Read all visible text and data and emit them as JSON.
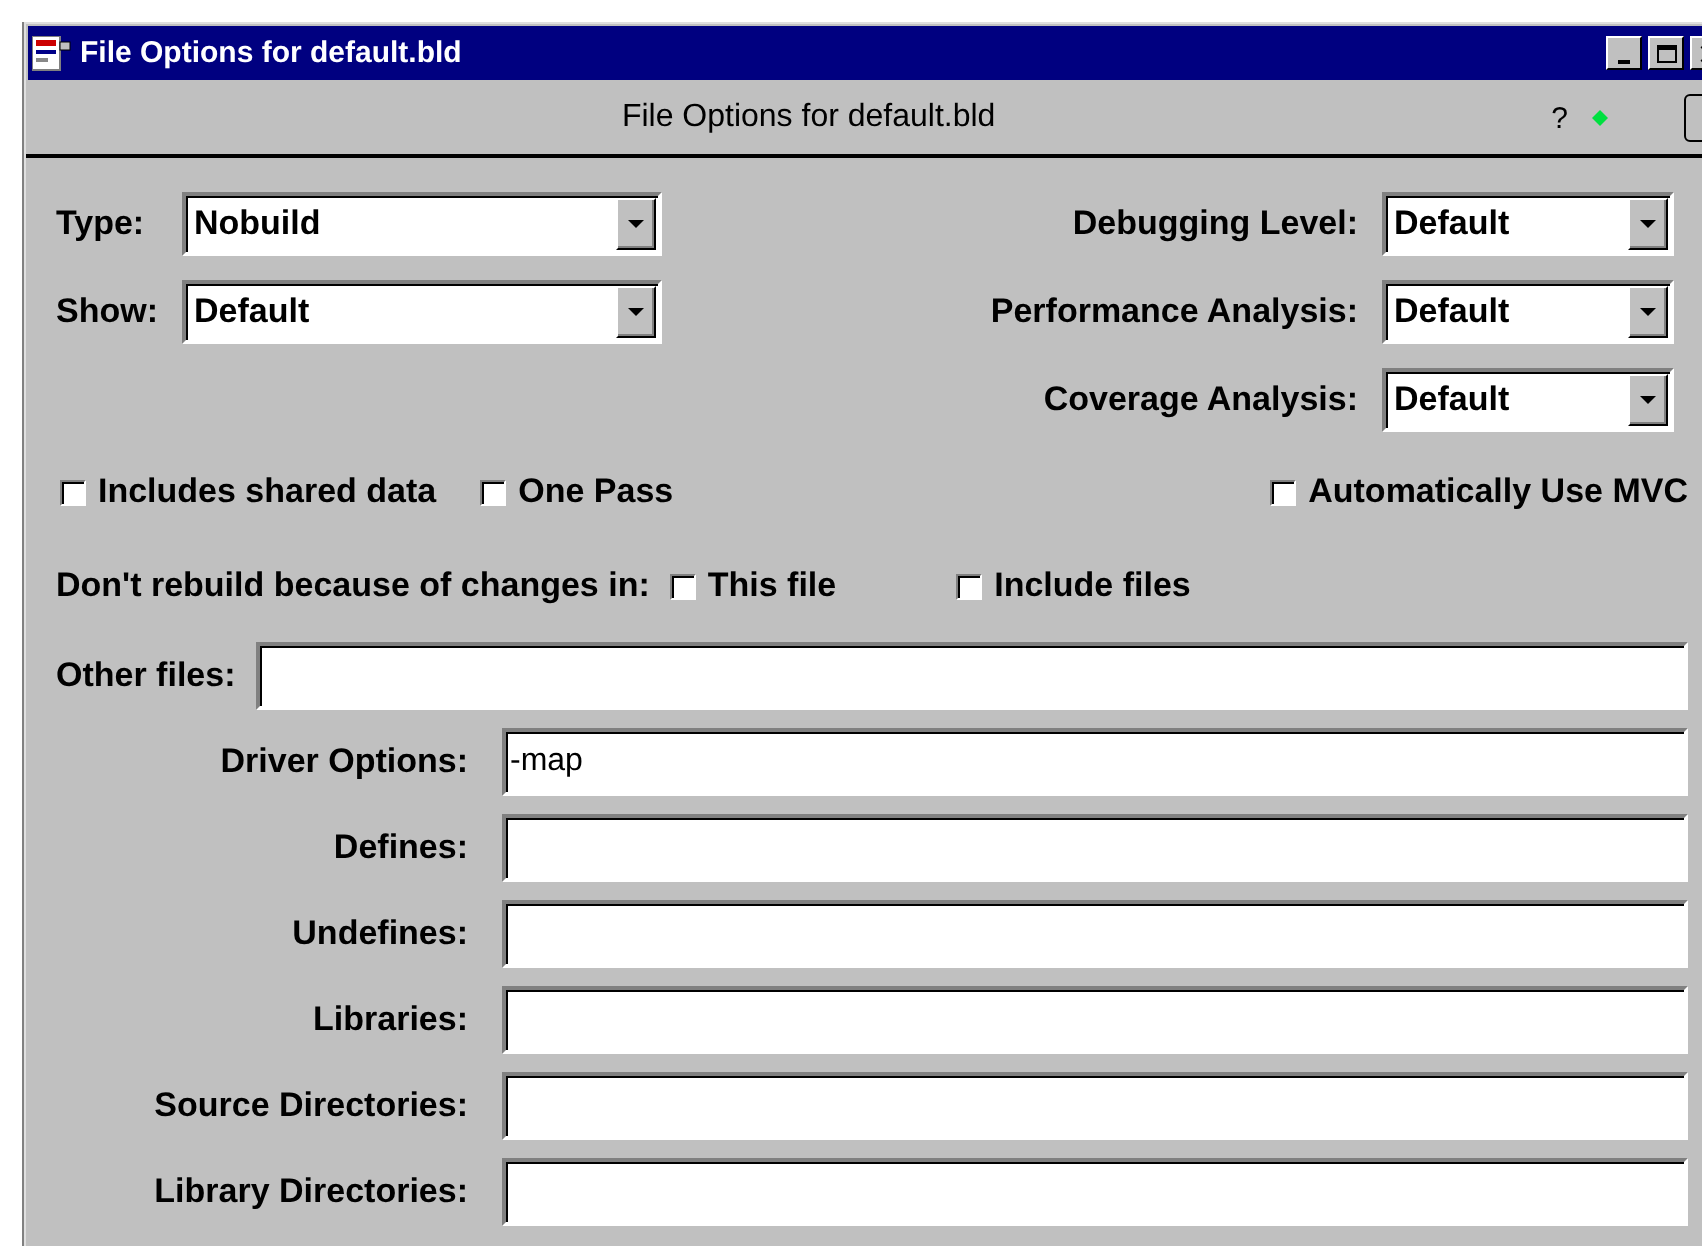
{
  "window": {
    "title": "File Options for default.bld"
  },
  "header": {
    "title": "File Options for default.bld",
    "help": "?"
  },
  "left_combos": [
    {
      "label": "Type:",
      "value": "Nobuild"
    },
    {
      "label": "Show:",
      "value": "Default"
    }
  ],
  "right_combos": [
    {
      "label": "Debugging Level:",
      "value": "Default"
    },
    {
      "label": "Performance Analysis:",
      "value": "Default"
    },
    {
      "label": "Coverage Analysis:",
      "value": "Default"
    }
  ],
  "options": [
    {
      "label": "Includes shared data",
      "checked": false
    },
    {
      "label": "One Pass",
      "checked": false
    },
    {
      "label": "Automatically Use MVC",
      "checked": false
    }
  ],
  "rebuild": {
    "label": "Don't rebuild because of changes in:",
    "checkboxes": [
      {
        "label": "This file",
        "checked": false
      },
      {
        "label": "Include files",
        "checked": false
      }
    ]
  },
  "other_files": {
    "label": "Other files:"
  },
  "fields": [
    {
      "label": "Driver Options:",
      "value": "-map"
    },
    {
      "label": "Defines:"
    },
    {
      "label": "Undefines:"
    },
    {
      "label": "Libraries:"
    },
    {
      "label": "Source Directories:"
    },
    {
      "label": "Library Directories:"
    }
  ]
}
